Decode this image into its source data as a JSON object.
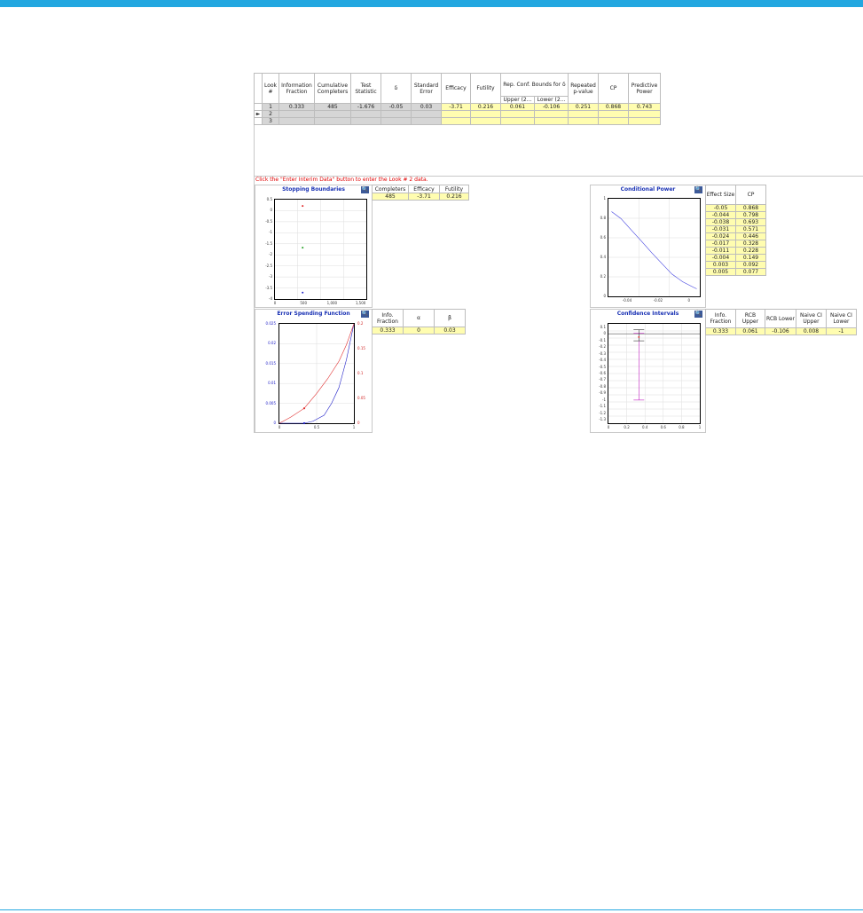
{
  "interim_table": {
    "headers": [
      "Look #",
      "Information Fraction",
      "Cumulative Completers",
      "Test Statistic",
      "δ",
      "Standard Error",
      "Efficacy",
      "Futility",
      "Rep. Conf. Bounds for δ",
      "Repeated p-value",
      "CP",
      "Predictive Power"
    ],
    "rcb_sub": [
      "Upper (2...",
      "Lower (2..."
    ],
    "rows": [
      {
        "look": "1",
        "info": "0.333",
        "completers": "485",
        "stat": "-1.676",
        "delta": "-0.05",
        "se": "0.03",
        "eff": "-3.71",
        "fut": "0.216",
        "upper": "0.061",
        "lower": "-0.106",
        "pval": "0.251",
        "cp": "0.868",
        "pp": "0.743"
      },
      {
        "look": "2"
      },
      {
        "look": "3"
      }
    ],
    "row_selector": "►"
  },
  "message": "Click the \"Enter Interim Data\" button to enter the Look # 2 data.",
  "stopping_boundaries": {
    "title": "Stopping Boundaries",
    "table": {
      "headers": [
        "Completers",
        "Efficacy",
        "Futility"
      ],
      "row": [
        "485",
        "-3.71",
        "0.216"
      ]
    },
    "chart_data": {
      "type": "scatter",
      "yticks": [
        "0.5",
        "0",
        "-0.5",
        "-1",
        "-1.5",
        "-2",
        "-2.5",
        "-3",
        "-3.5",
        "-4"
      ],
      "xticks": [
        "0",
        "500",
        "1,000",
        "1,500"
      ],
      "xlim": [
        0,
        1600
      ],
      "ylim": [
        -4,
        0.5
      ],
      "series": [
        {
          "color": "#e02020",
          "points": [
            [
              485,
              0.216
            ]
          ]
        },
        {
          "color": "#22a022",
          "points": [
            [
              485,
              -1.676
            ]
          ]
        },
        {
          "color": "#2020c8",
          "points": [
            [
              485,
              -3.71
            ]
          ]
        }
      ]
    }
  },
  "conditional_power": {
    "title": "Conditional Power",
    "table": {
      "headers": [
        "Effect Size",
        "CP"
      ],
      "rows": [
        [
          "-0.05",
          "0.868"
        ],
        [
          "-0.044",
          "0.798"
        ],
        [
          "-0.038",
          "0.693"
        ],
        [
          "-0.031",
          "0.571"
        ],
        [
          "-0.024",
          "0.446"
        ],
        [
          "-0.017",
          "0.328"
        ],
        [
          "-0.011",
          "0.228"
        ],
        [
          "-0.004",
          "0.149"
        ],
        [
          "0.003",
          "0.092"
        ],
        [
          "0.005",
          "0.077"
        ]
      ]
    },
    "chart_data": {
      "type": "line",
      "xticks": [
        "-0.04",
        "-0.02",
        "0"
      ],
      "yticks": [
        "1",
        "0.8",
        "0.6",
        "0.4",
        "0.2",
        "0"
      ],
      "xlim": [
        -0.052,
        0.007
      ],
      "ylim": [
        0,
        1
      ],
      "x": [
        -0.05,
        -0.044,
        -0.038,
        -0.031,
        -0.024,
        -0.017,
        -0.011,
        -0.004,
        0.003,
        0.005
      ],
      "y": [
        0.868,
        0.798,
        0.693,
        0.571,
        0.446,
        0.328,
        0.228,
        0.149,
        0.092,
        0.077
      ],
      "color": "#4040e0"
    }
  },
  "error_spending": {
    "title": "Error Spending Function",
    "table": {
      "headers": [
        "Info. Fraction",
        "α",
        "β"
      ],
      "row": [
        "0.333",
        "0",
        "0.03"
      ]
    },
    "chart_data": {
      "type": "line",
      "xticks": [
        "0",
        "0.5",
        "1"
      ],
      "yticks_left": [
        "0.025",
        "0.02",
        "0.015",
        "0.01",
        "0.005",
        "0"
      ],
      "yticks_right": [
        "0.2",
        "0.15",
        "0.1",
        "0.05",
        "0"
      ],
      "xlim": [
        0,
        1
      ],
      "ylim_left": [
        0,
        0.025
      ],
      "ylim_right": [
        0,
        0.2
      ],
      "series": [
        {
          "name": "α",
          "axis": "left",
          "color": "#2020c8",
          "x": [
            0,
            0.2,
            0.333,
            0.45,
            0.6,
            0.7,
            0.8,
            0.9,
            1
          ],
          "y": [
            0,
            0,
            0,
            0.0005,
            0.002,
            0.005,
            0.009,
            0.016,
            0.025
          ],
          "marker": [
            0.333,
            0
          ]
        },
        {
          "name": "β",
          "axis": "right",
          "color": "#e03030",
          "x": [
            0,
            0.15,
            0.333,
            0.5,
            0.65,
            0.8,
            0.9,
            1
          ],
          "y": [
            0,
            0.012,
            0.03,
            0.06,
            0.09,
            0.125,
            0.158,
            0.2
          ],
          "marker": [
            0.333,
            0.03
          ]
        }
      ]
    }
  },
  "confidence_intervals": {
    "title": "Confidence Intervals",
    "table": {
      "headers": [
        "Info. Fraction",
        "RCB Upper",
        "RCB Lower",
        "Naive CI Upper",
        "Naive CI Lower"
      ],
      "row": [
        "0.333",
        "0.061",
        "-0.106",
        "0.008",
        "-1"
      ]
    },
    "chart_data": {
      "type": "interval",
      "xticks": [
        "0",
        "0.2",
        "0.4",
        "0.6",
        "0.8",
        "1"
      ],
      "yticks": [
        "0.1",
        "0",
        "-0.1",
        "-0.2",
        "-0.3",
        "-0.4",
        "-0.5",
        "-0.6",
        "-0.7",
        "-0.8",
        "-0.9",
        "-1",
        "-1.1",
        "-1.2",
        "-1.3"
      ],
      "xlim": [
        0,
        1
      ],
      "ylim": [
        -1.35,
        0.15
      ],
      "rcb": {
        "x": 0.333,
        "upper": 0.061,
        "lower": -0.106,
        "color": "#333333"
      },
      "naive": {
        "x": 0.333,
        "upper": 0.008,
        "lower": -1,
        "color": "#c020c0"
      },
      "estimate": {
        "x": 0.333,
        "y": -0.05,
        "color": "#e02020"
      },
      "zero_line": 0
    }
  },
  "zoom_icon": "magnifier-icon"
}
